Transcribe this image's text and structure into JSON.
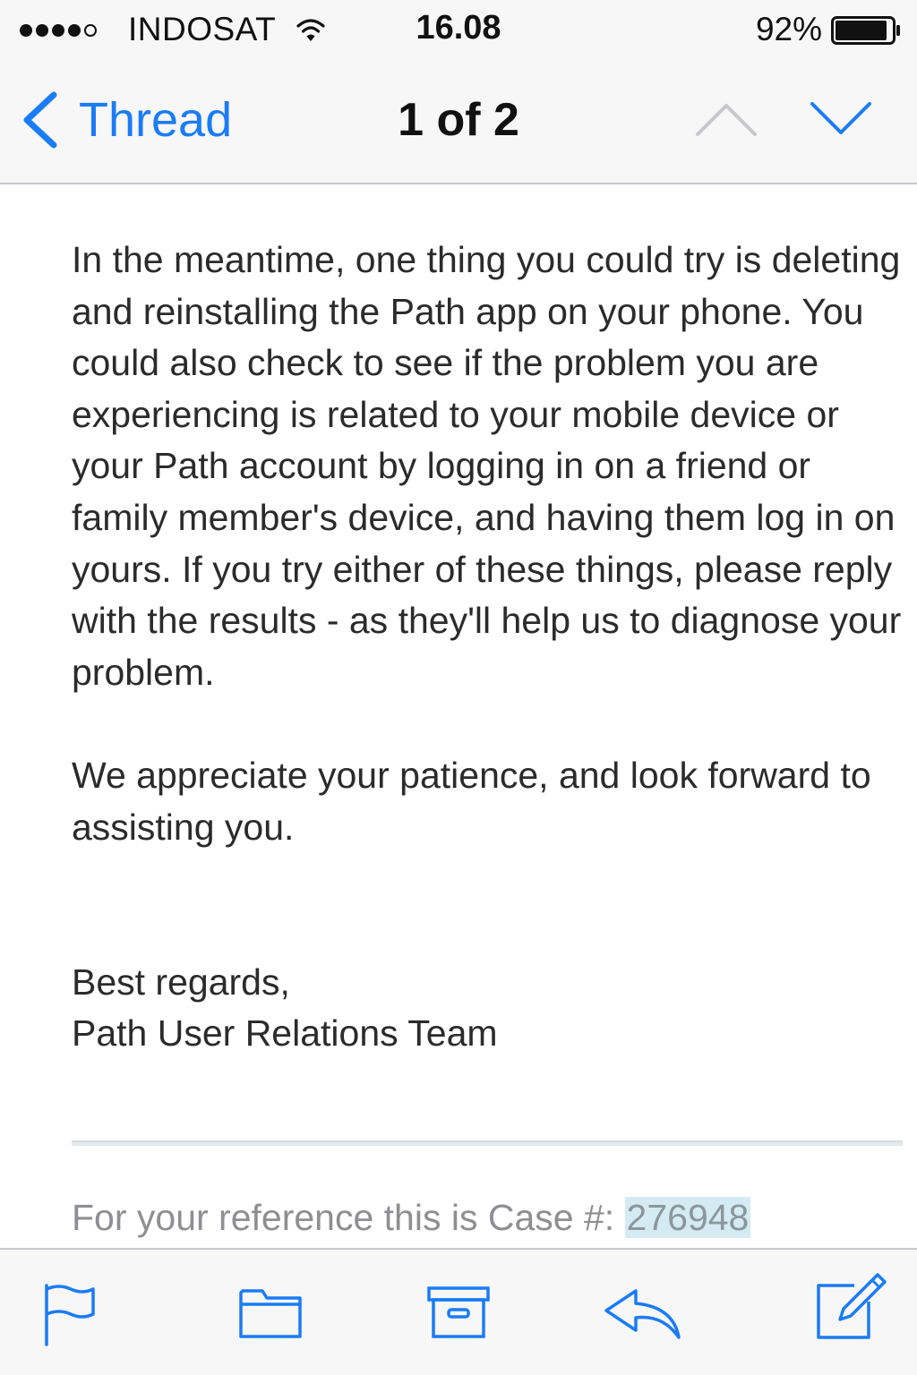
{
  "status_bar": {
    "carrier": "INDOSAT",
    "signal_bars_filled": 4,
    "signal_bars_total": 5,
    "time": "16.08",
    "battery_percent": "92%",
    "battery_level": 0.92
  },
  "nav": {
    "back_label": "Thread",
    "title": "1 of 2",
    "icons": {
      "back": "chevron-left-icon",
      "previous": "chevron-up-icon",
      "next": "chevron-down-icon"
    }
  },
  "message": {
    "paragraphs": [
      "In the meantime, one thing you could try is deleting and reinstalling the Path app on your phone. You could also check to see if the problem you are experiencing is related to your mobile device or your Path account by logging in on a friend or family member's device, and having them log in on yours. If you try either of these things, please reply with the results - as they'll help us to diagnose your problem.",
      "We appreciate your patience, and look forward to assisting you."
    ],
    "signoff": "Best regards,",
    "signature": "Path User Relations Team",
    "case_prefix": "For your reference this is Case #: ",
    "case_number": "276948"
  },
  "toolbar": {
    "icons": [
      "flag-icon",
      "folder-icon",
      "archive-icon",
      "reply-icon",
      "compose-icon"
    ]
  },
  "colors": {
    "accent": "#1a7cf6",
    "text": "#2b2b2b",
    "muted_text": "#8e8e93",
    "case_highlight": "#d4ebf4",
    "chrome_background": "#f7f7f8",
    "disabled_arrow": "#c7c7cc"
  }
}
